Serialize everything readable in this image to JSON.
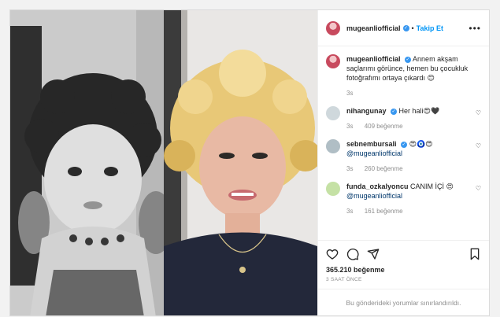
{
  "post": {
    "username": "mugeanliofficial",
    "follow_label": "Takip Et",
    "more_label": "•••",
    "caption": {
      "username": "mugeanliofficial",
      "text": "Annem akşam saçlarımı görünce, hemen bu çocukluk fotoğrafımı ortaya çıkardı 😊",
      "time": "3s"
    },
    "comments": [
      {
        "username": "nihangunay",
        "text": "Her hali😍🖤",
        "time": "3s",
        "likes": "409 beğenme",
        "avatar_color": "#cfd8dc"
      },
      {
        "username": "sebnembursali",
        "text": "😍🧿😍",
        "mention": "@mugeanliofficial",
        "time": "3s",
        "likes": "260 beğenme",
        "avatar_color": "#b0bec5"
      },
      {
        "username": "funda_ozkalyoncu",
        "text": "CANIM İÇİ 😍",
        "mention": "@mugeanliofficial",
        "time": "3s",
        "likes": "161 beğenme",
        "avatar_color": "#c5e1a5"
      }
    ],
    "likes": "365.210 beğenme",
    "timestamp": "3 SAAT ÖNCE",
    "comments_disabled": "Bu gönderideki yorumlar sınırlandırıldı."
  }
}
